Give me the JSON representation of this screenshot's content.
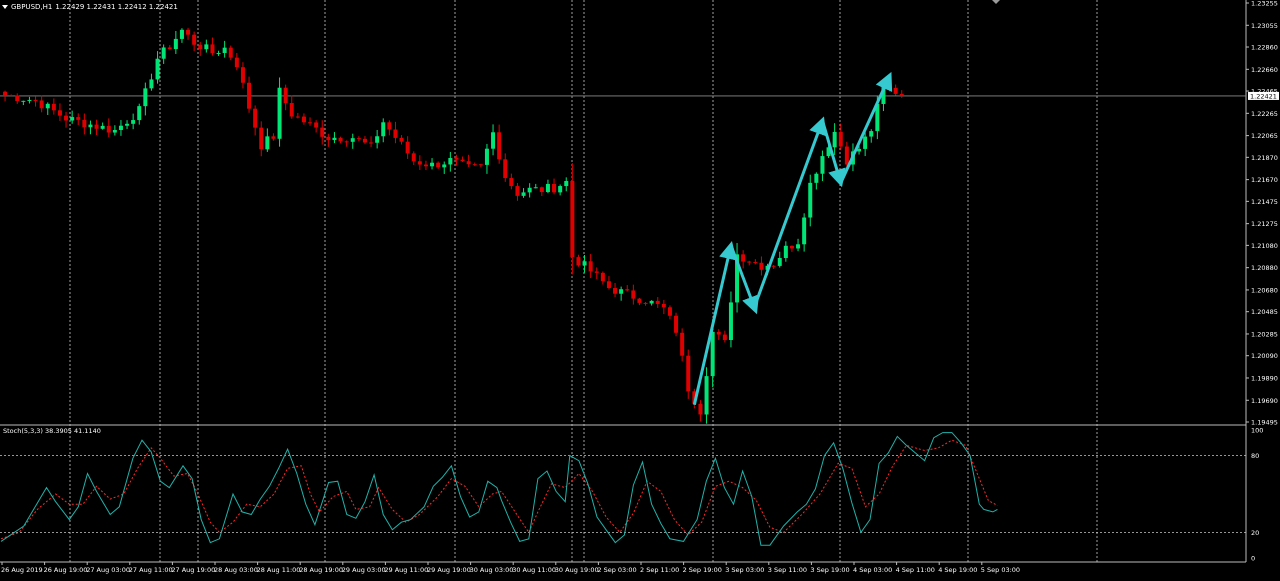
{
  "header": {
    "symbol_label": "GBPUSD,H1",
    "ohlc": "1.22429 1.22431 1.22412 1.22421"
  },
  "stoch_header": {
    "label": "Stoch(5,3,3) 38.3905 41.1140"
  },
  "colors": {
    "background": "#000000",
    "bull": "#00e676",
    "bear": "#e00000",
    "grid": "#c8c8c8",
    "arrow": "#36c9d0",
    "main_line": "#20b2aa",
    "signal_line": "#ff2a2a",
    "axis_text": "#ffffff"
  },
  "price_axis": {
    "labels": [
      "1.23255",
      "1.23055",
      "1.22860",
      "1.22660",
      "1.22465",
      "1.22265",
      "1.22065",
      "1.21870",
      "1.21670",
      "1.21475",
      "1.21275",
      "1.21080",
      "1.20880",
      "1.20680",
      "1.20485",
      "1.20285",
      "1.20090",
      "1.19890",
      "1.19690",
      "1.19495"
    ],
    "current_price": "1.22421"
  },
  "stoch_axis": {
    "labels": [
      "100",
      "80",
      "20",
      "0"
    ]
  },
  "time_axis": {
    "labels": [
      "26 Aug 2019",
      "26 Aug 19:00",
      "27 Aug 03:00",
      "27 Aug 11:00",
      "27 Aug 19:00",
      "28 Aug 03:00",
      "28 Aug 11:00",
      "28 Aug 19:00",
      "29 Aug 03:00",
      "29 Aug 11:00",
      "29 Aug 19:00",
      "30 Aug 03:00",
      "30 Aug 11:00",
      "30 Aug 19:00",
      "2 Sep 03:00",
      "2 Sep 11:00",
      "2 Sep 19:00",
      "3 Sep 03:00",
      "3 Sep 11:00",
      "3 Sep 19:00",
      "4 Sep 03:00",
      "4 Sep 11:00",
      "4 Sep 19:00",
      "5 Sep 03:00"
    ]
  },
  "chart_data": {
    "type": "candlestick",
    "symbol": "GBPUSD",
    "timeframe": "H1",
    "current_price": 1.22421,
    "ylim": [
      1.19495,
      1.23255
    ],
    "close_path": [
      [
        0,
        1.2243
      ],
      [
        5,
        1.2238
      ],
      [
        10,
        1.2222
      ],
      [
        15,
        1.2215
      ],
      [
        18,
        1.2211
      ],
      [
        22,
        1.2229
      ],
      [
        25,
        1.2276
      ],
      [
        27,
        1.2287
      ],
      [
        29,
        1.2301
      ],
      [
        31,
        1.229
      ],
      [
        34,
        1.2281
      ],
      [
        36,
        1.2285
      ],
      [
        38,
        1.2271
      ],
      [
        40,
        1.2232
      ],
      [
        42,
        1.2198
      ],
      [
        44,
        1.2206
      ],
      [
        45,
        1.2246
      ],
      [
        47,
        1.2226
      ],
      [
        50,
        1.2216
      ],
      [
        53,
        1.2205
      ],
      [
        57,
        1.2205
      ],
      [
        60,
        1.2196
      ],
      [
        62,
        1.2219
      ],
      [
        64,
        1.2205
      ],
      [
        67,
        1.2184
      ],
      [
        70,
        1.218
      ],
      [
        73,
        1.2184
      ],
      [
        76,
        1.2177
      ],
      [
        78,
        1.2178
      ],
      [
        80,
        1.2209
      ],
      [
        82,
        1.217
      ],
      [
        84,
        1.2155
      ],
      [
        86,
        1.2158
      ],
      [
        88,
        1.2158
      ],
      [
        90,
        1.216
      ],
      [
        92,
        1.2165
      ],
      [
        93,
        1.2098
      ],
      [
        96,
        1.2085
      ],
      [
        99,
        1.207
      ],
      [
        102,
        1.2064
      ],
      [
        105,
        1.2059
      ],
      [
        108,
        1.2051
      ],
      [
        110,
        1.2032
      ],
      [
        112,
        1.198
      ],
      [
        114,
        1.196
      ],
      [
        116,
        1.203
      ],
      [
        118,
        1.202
      ],
      [
        120,
        1.21
      ],
      [
        122,
        1.2095
      ],
      [
        124,
        1.209
      ],
      [
        126,
        1.2092
      ],
      [
        128,
        1.2105
      ],
      [
        130,
        1.2112
      ],
      [
        132,
        1.2163
      ],
      [
        134,
        1.2189
      ],
      [
        136,
        1.221
      ],
      [
        138,
        1.2185
      ],
      [
        140,
        1.2195
      ],
      [
        142,
        1.2212
      ],
      [
        144,
        1.225
      ],
      [
        146,
        1.2246
      ],
      [
        147,
        1.2242
      ]
    ],
    "arrows": [
      {
        "from": [
          113,
          1.1965
        ],
        "to": [
          119,
          1.2108
        ]
      },
      {
        "from": [
          119,
          1.2108
        ],
        "to": [
          123,
          1.205
        ]
      },
      {
        "from": [
          123,
          1.2055
        ],
        "to": [
          134,
          1.222
        ]
      },
      {
        "from": [
          134,
          1.222
        ],
        "to": [
          137,
          1.2164
        ]
      },
      {
        "from": [
          137,
          1.2164
        ],
        "to": [
          145,
          1.226
        ]
      }
    ],
    "stochastic": {
      "main": [
        [
          0,
          13
        ],
        [
          5,
          25
        ],
        [
          10,
          55
        ],
        [
          12,
          44
        ],
        [
          15,
          30
        ],
        [
          17,
          40
        ],
        [
          19,
          66
        ],
        [
          21,
          52
        ],
        [
          24,
          34
        ],
        [
          26,
          40
        ],
        [
          29,
          78
        ],
        [
          31,
          92
        ],
        [
          33,
          83
        ],
        [
          35,
          60
        ],
        [
          37,
          55
        ],
        [
          40,
          72
        ],
        [
          42,
          62
        ],
        [
          44,
          30
        ],
        [
          46,
          12
        ],
        [
          48,
          15
        ],
        [
          51,
          50
        ],
        [
          53,
          36
        ],
        [
          55,
          34
        ],
        [
          57,
          46
        ],
        [
          59,
          56
        ],
        [
          61,
          70
        ],
        [
          63,
          85
        ],
        [
          65,
          66
        ],
        [
          67,
          42
        ],
        [
          69,
          26
        ],
        [
          72,
          59
        ],
        [
          74,
          60
        ],
        [
          76,
          34
        ],
        [
          78,
          31
        ],
        [
          80,
          44
        ],
        [
          82,
          65
        ],
        [
          84,
          34
        ],
        [
          86,
          22
        ],
        [
          88,
          28
        ],
        [
          90,
          30
        ],
        [
          93,
          40
        ],
        [
          95,
          56
        ],
        [
          97,
          63
        ],
        [
          99,
          72
        ],
        [
          101,
          48
        ],
        [
          103,
          32
        ],
        [
          105,
          36
        ],
        [
          107,
          60
        ],
        [
          109,
          55
        ],
        [
          110,
          45
        ],
        [
          112,
          28
        ],
        [
          114,
          13
        ],
        [
          116,
          15
        ],
        [
          118,
          62
        ],
        [
          120,
          68
        ],
        [
          122,
          52
        ],
        [
          124,
          44
        ],
        [
          125,
          80
        ],
        [
          127,
          76
        ],
        [
          129,
          58
        ],
        [
          131,
          32
        ],
        [
          133,
          22
        ],
        [
          135,
          12
        ],
        [
          137,
          18
        ],
        [
          139,
          57
        ],
        [
          141,
          75
        ],
        [
          143,
          42
        ],
        [
          145,
          27
        ],
        [
          147,
          15
        ],
        [
          150,
          13
        ],
        [
          153,
          30
        ],
        [
          155,
          60
        ],
        [
          157,
          78
        ],
        [
          159,
          55
        ],
        [
          161,
          42
        ],
        [
          163,
          68
        ],
        [
          165,
          48
        ],
        [
          167,
          10
        ],
        [
          169,
          10
        ],
        [
          172,
          25
        ],
        [
          175,
          36
        ],
        [
          177,
          42
        ],
        [
          179,
          54
        ],
        [
          181,
          80
        ],
        [
          183,
          90
        ],
        [
          185,
          70
        ],
        [
          187,
          43
        ],
        [
          189,
          20
        ],
        [
          191,
          30
        ],
        [
          193,
          74
        ],
        [
          195,
          82
        ],
        [
          197,
          95
        ],
        [
          199,
          88
        ],
        [
          201,
          82
        ],
        [
          203,
          76
        ],
        [
          205,
          94
        ],
        [
          207,
          98
        ],
        [
          209,
          98
        ],
        [
          211,
          90
        ],
        [
          213,
          80
        ],
        [
          215,
          42
        ],
        [
          216,
          38
        ],
        [
          217,
          37
        ],
        [
          218,
          36
        ],
        [
          219,
          38
        ]
      ],
      "signal": [
        [
          0,
          15
        ],
        [
          4,
          20
        ],
        [
          8,
          38
        ],
        [
          12,
          50
        ],
        [
          15,
          42
        ],
        [
          18,
          42
        ],
        [
          21,
          56
        ],
        [
          24,
          46
        ],
        [
          27,
          50
        ],
        [
          30,
          70
        ],
        [
          33,
          86
        ],
        [
          35,
          78
        ],
        [
          38,
          64
        ],
        [
          41,
          66
        ],
        [
          43,
          52
        ],
        [
          46,
          28
        ],
        [
          48,
          20
        ],
        [
          51,
          28
        ],
        [
          54,
          42
        ],
        [
          57,
          40
        ],
        [
          60,
          50
        ],
        [
          63,
          70
        ],
        [
          66,
          72
        ],
        [
          68,
          50
        ],
        [
          70,
          36
        ],
        [
          73,
          48
        ],
        [
          76,
          52
        ],
        [
          78,
          38
        ],
        [
          81,
          40
        ],
        [
          83,
          55
        ],
        [
          86,
          38
        ],
        [
          89,
          28
        ],
        [
          92,
          34
        ],
        [
          96,
          48
        ],
        [
          99,
          62
        ],
        [
          102,
          56
        ],
        [
          105,
          40
        ],
        [
          108,
          50
        ],
        [
          110,
          52
        ],
        [
          113,
          36
        ],
        [
          116,
          20
        ],
        [
          118,
          36
        ],
        [
          121,
          58
        ],
        [
          124,
          55
        ],
        [
          127,
          66
        ],
        [
          130,
          52
        ],
        [
          133,
          32
        ],
        [
          136,
          20
        ],
        [
          139,
          35
        ],
        [
          142,
          60
        ],
        [
          145,
          52
        ],
        [
          148,
          30
        ],
        [
          151,
          18
        ],
        [
          154,
          28
        ],
        [
          157,
          56
        ],
        [
          160,
          60
        ],
        [
          163,
          55
        ],
        [
          166,
          45
        ],
        [
          169,
          24
        ],
        [
          172,
          20
        ],
        [
          176,
          34
        ],
        [
          180,
          50
        ],
        [
          184,
          74
        ],
        [
          187,
          70
        ],
        [
          190,
          40
        ],
        [
          193,
          50
        ],
        [
          196,
          72
        ],
        [
          199,
          88
        ],
        [
          203,
          84
        ],
        [
          206,
          86
        ],
        [
          209,
          92
        ],
        [
          212,
          88
        ],
        [
          215,
          62
        ],
        [
          217,
          45
        ],
        [
          219,
          41
        ]
      ]
    }
  }
}
